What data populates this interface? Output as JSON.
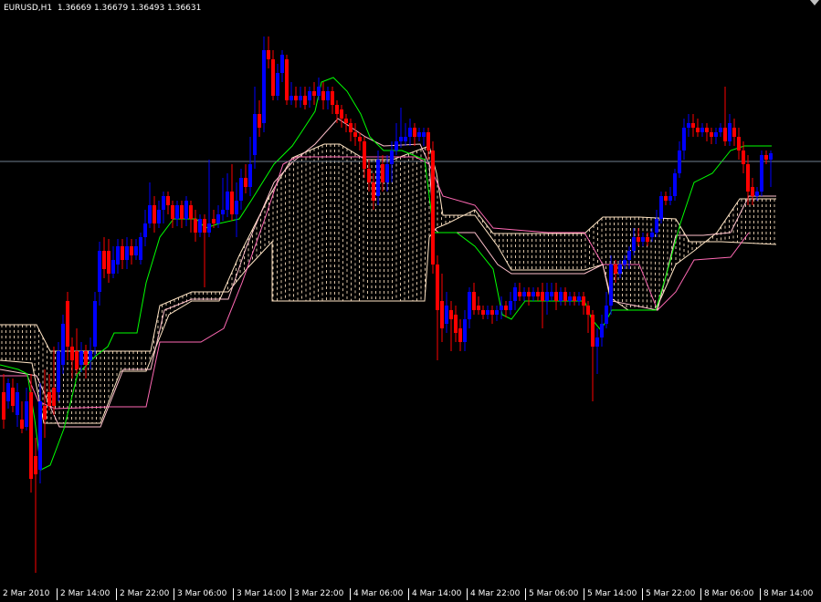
{
  "window": {
    "symbol": "EURUSD,H1",
    "ohlc": [
      "1.36669",
      "1.36679",
      "1.36493",
      "1.36631"
    ]
  },
  "colors": {
    "background": "#000000",
    "bull_candle": "#0000ff",
    "bear_candle": "#ff0000",
    "tenkan": "#00ff00",
    "kijun": "#ffc0cb",
    "cloud_hatch": "#ffe4c4",
    "senkou_b": "#ff69b4",
    "price_line": "#708090"
  },
  "icons": {
    "scroll": "triangle-down-icon"
  },
  "xaxis_labels": [
    "2 Mar 2010",
    "2 Mar 14:00",
    "2 Mar 22:00",
    "3 Mar 06:00",
    "3 Mar 14:00",
    "3 Mar 22:00",
    "4 Mar 06:00",
    "4 Mar 14:00",
    "4 Mar 22:00",
    "5 Mar 06:00",
    "5 Mar 14:00",
    "5 Mar 22:00",
    "8 Mar 06:00",
    "8 Mar 14:00"
  ],
  "chart_data": {
    "type": "candlestick",
    "indicator": "Ichimoku Kinko Hyo",
    "last_close": 1.36631
  }
}
